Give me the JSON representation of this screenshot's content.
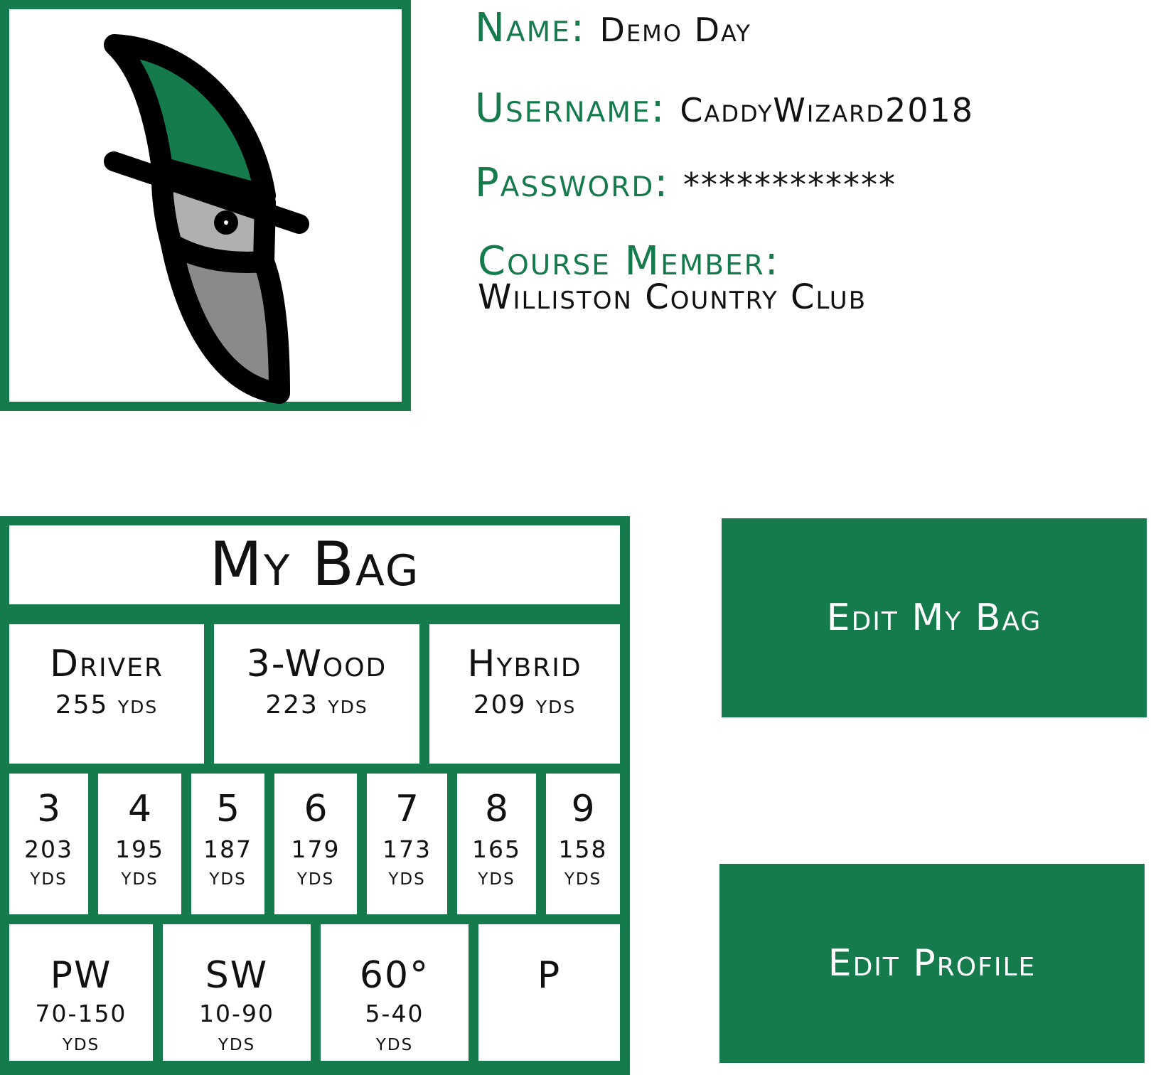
{
  "profile": {
    "name_label": "Name:",
    "name_value": "Demo Day",
    "username_label": "Username:",
    "username_value": "CaddyWizard2018",
    "password_label": "Password:",
    "password_value": "************",
    "course_label": "Course Member:",
    "course_value": "Williston Country Club"
  },
  "bag": {
    "title": "My Bag",
    "woods": [
      {
        "club": "Driver",
        "distance": "255 yds"
      },
      {
        "club": "3-Wood",
        "distance": "223 yds"
      },
      {
        "club": "Hybrid",
        "distance": "209 yds"
      }
    ],
    "irons": [
      {
        "club": "3",
        "distance": "203",
        "unit": "yds"
      },
      {
        "club": "4",
        "distance": "195",
        "unit": "yds"
      },
      {
        "club": "5",
        "distance": "187",
        "unit": "yds"
      },
      {
        "club": "6",
        "distance": "179",
        "unit": "yds"
      },
      {
        "club": "7",
        "distance": "173",
        "unit": "yds"
      },
      {
        "club": "8",
        "distance": "165",
        "unit": "yds"
      },
      {
        "club": "9",
        "distance": "158",
        "unit": "yds"
      }
    ],
    "wedges": [
      {
        "club": "PW",
        "distance": "70-150",
        "unit": "yds"
      },
      {
        "club": "SW",
        "distance": "10-90",
        "unit": "yds"
      },
      {
        "club": "60°",
        "distance": "5-40",
        "unit": "yds"
      },
      {
        "club": "P",
        "distance": "",
        "unit": ""
      }
    ]
  },
  "actions": {
    "edit_bag_label": "Edit My Bag",
    "edit_profile_label": "Edit Profile"
  },
  "colors": {
    "brand_green": "#157a4c",
    "text": "#111111",
    "background": "#ffffff"
  },
  "icons": {
    "avatar": "wizard-logo-icon"
  }
}
